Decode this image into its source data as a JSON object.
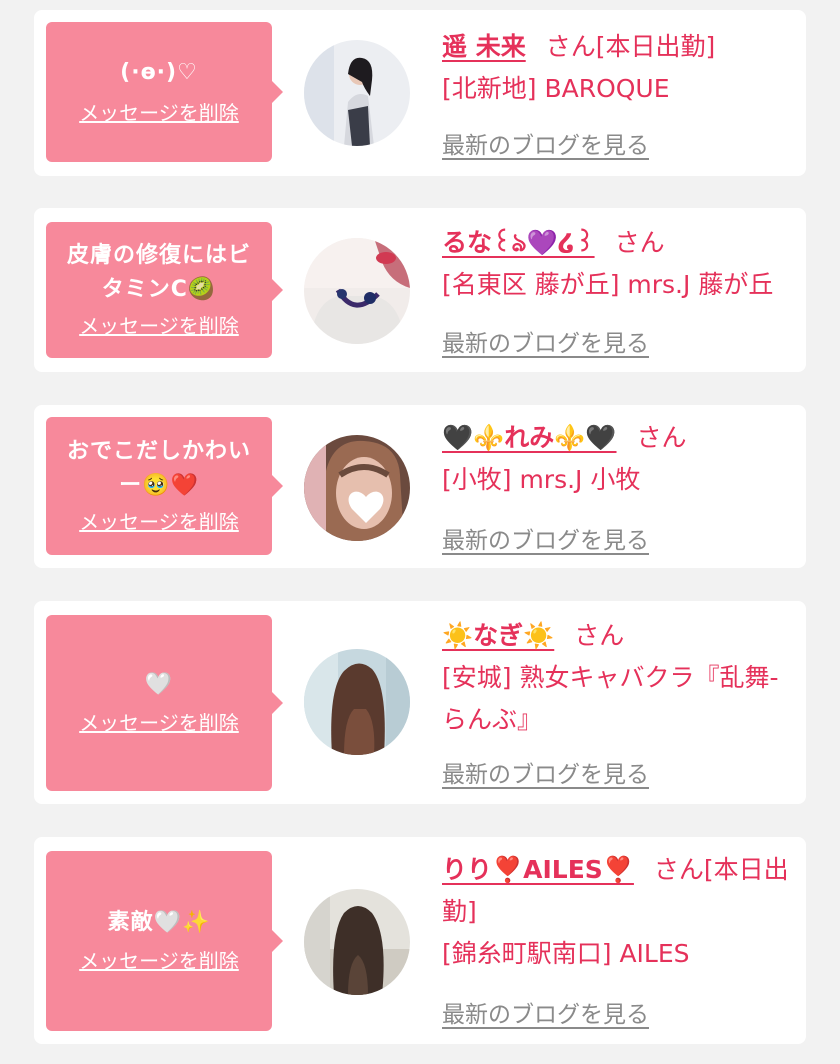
{
  "colors": {
    "page_background": "#f2f2f2",
    "card_background": "#ffffff",
    "bubble": "#f7899b",
    "name_text": "#e5315a",
    "blog_link": "#8a8a8a"
  },
  "items": [
    {
      "message": "(·ɵ·)♡",
      "delete_label": "メッセージを削除",
      "name": "遥 未来",
      "san_status": "さん[本日出勤]",
      "shop": "[北新地] BAROQUE",
      "blog_label": "最新のブログを見る"
    },
    {
      "message": "皮膚の修復にはビタミンC🥝",
      "delete_label": "メッセージを削除",
      "name": "るな꒰ঌ💜໒꒱",
      "san_status": "さん",
      "shop": "[名東区 藤が丘] mrs.J 藤が丘",
      "blog_label": "最新のブログを見る"
    },
    {
      "message": "おでこだしかわいー🥹❤️",
      "delete_label": "メッセージを削除",
      "name": "🖤⚜️れみ⚜️🖤",
      "san_status": "さん",
      "shop": "[小牧] mrs.J 小牧",
      "blog_label": "最新のブログを見る"
    },
    {
      "message": "🤍",
      "delete_label": "メッセージを削除",
      "name": "☀️なぎ☀️",
      "san_status": "さん",
      "shop": "[安城] 熟女キャバクラ『乱舞-らんぶ』",
      "blog_label": "最新のブログを見る"
    },
    {
      "message": "素敵🤍✨",
      "delete_label": "メッセージを削除",
      "name": "りり❣️AILES❣️",
      "san_status": "さん[本日出勤]",
      "shop": "[錦糸町駅南口] AILES",
      "blog_label": "最新のブログを見る"
    }
  ]
}
